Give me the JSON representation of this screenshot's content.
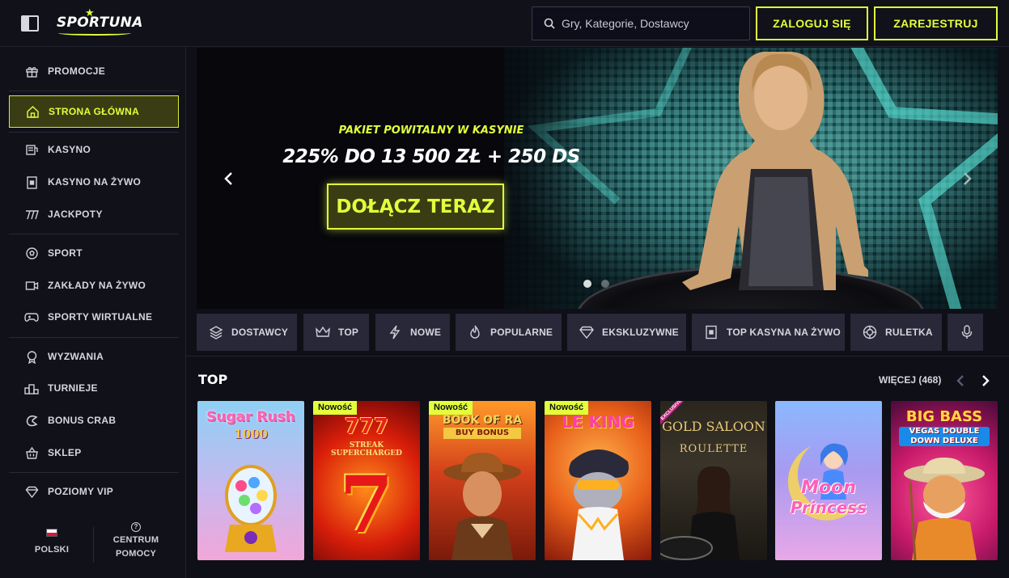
{
  "header": {
    "logo_text": "SPORTUNA",
    "search_placeholder": "Gry, Kategorie, Dostawcy",
    "login_label": "ZALOGUJ SIĘ",
    "register_label": "ZAREJESTRUJ"
  },
  "sidebar": {
    "items": [
      {
        "label": "PROMOCJE",
        "icon": "gift-icon"
      },
      {
        "label": "STRONA GŁÓWNA",
        "icon": "home-icon",
        "active": true
      },
      {
        "label": "KASYNO",
        "icon": "casino-icon"
      },
      {
        "label": "KASYNO NA ŻYWO",
        "icon": "live-casino-icon"
      },
      {
        "label": "JACKPOTY",
        "icon": "jackpot-icon"
      },
      {
        "label": "SPORT",
        "icon": "soccer-ball-icon"
      },
      {
        "label": "ZAKŁADY NA ŻYWO",
        "icon": "video-camera-icon"
      },
      {
        "label": "SPORTY WIRTUALNE",
        "icon": "gamepad-icon"
      },
      {
        "label": "WYZWANIA",
        "icon": "medal-icon"
      },
      {
        "label": "TURNIEJE",
        "icon": "podium-icon"
      },
      {
        "label": "BONUS CRAB",
        "icon": "crab-claw-icon"
      },
      {
        "label": "SKLEP",
        "icon": "basket-icon"
      },
      {
        "label": "POZIOMY VIP",
        "icon": "diamond-icon"
      }
    ],
    "language_label": "POLSKI",
    "help_label_1": "CENTRUM",
    "help_label_2": "POMOCY"
  },
  "banner": {
    "subtitle": "PAKIET POWITALNY W KASYNIE",
    "title": "225% DO 13 500 ZŁ + 250 DS",
    "cta_label": "DOŁĄCZ TERAZ"
  },
  "categories": [
    {
      "label": "DOSTAWCY",
      "icon": "layers-icon"
    },
    {
      "label": "TOP",
      "icon": "crown-icon"
    },
    {
      "label": "NOWE",
      "icon": "lightning-icon"
    },
    {
      "label": "POPULARNE",
      "icon": "flame-icon"
    },
    {
      "label": "EKSKLUZYWNE",
      "icon": "diamond-icon"
    },
    {
      "label": "TOP KASYNA NA ŻYWO",
      "icon": "live-casino-icon"
    },
    {
      "label": "RULETKA",
      "icon": "roulette-icon"
    },
    {
      "label": "",
      "icon": "microphone-icon"
    }
  ],
  "top_section": {
    "title": "TOP",
    "more_label": "WIĘCEJ (468)"
  },
  "games": [
    {
      "title": "Sugar Rush",
      "subtitle": "1000",
      "badge": ""
    },
    {
      "title": "777",
      "subtitle": "STREAK SUPERCHARGED",
      "badge": "Nowość"
    },
    {
      "title": "BOOK OF RA",
      "subtitle": "BUY BONUS",
      "badge": "Nowość"
    },
    {
      "title": "LE KING",
      "subtitle": "",
      "badge": "Nowość"
    },
    {
      "title": "GOLD SALOON",
      "subtitle": "ROULETTE",
      "badge": "EXCLUSIVE"
    },
    {
      "title": "Moon",
      "subtitle": "Princess",
      "badge": ""
    },
    {
      "title": "BIG BASS",
      "subtitle": "VEGAS DOUBLE DOWN DELUXE",
      "badge": ""
    }
  ]
}
